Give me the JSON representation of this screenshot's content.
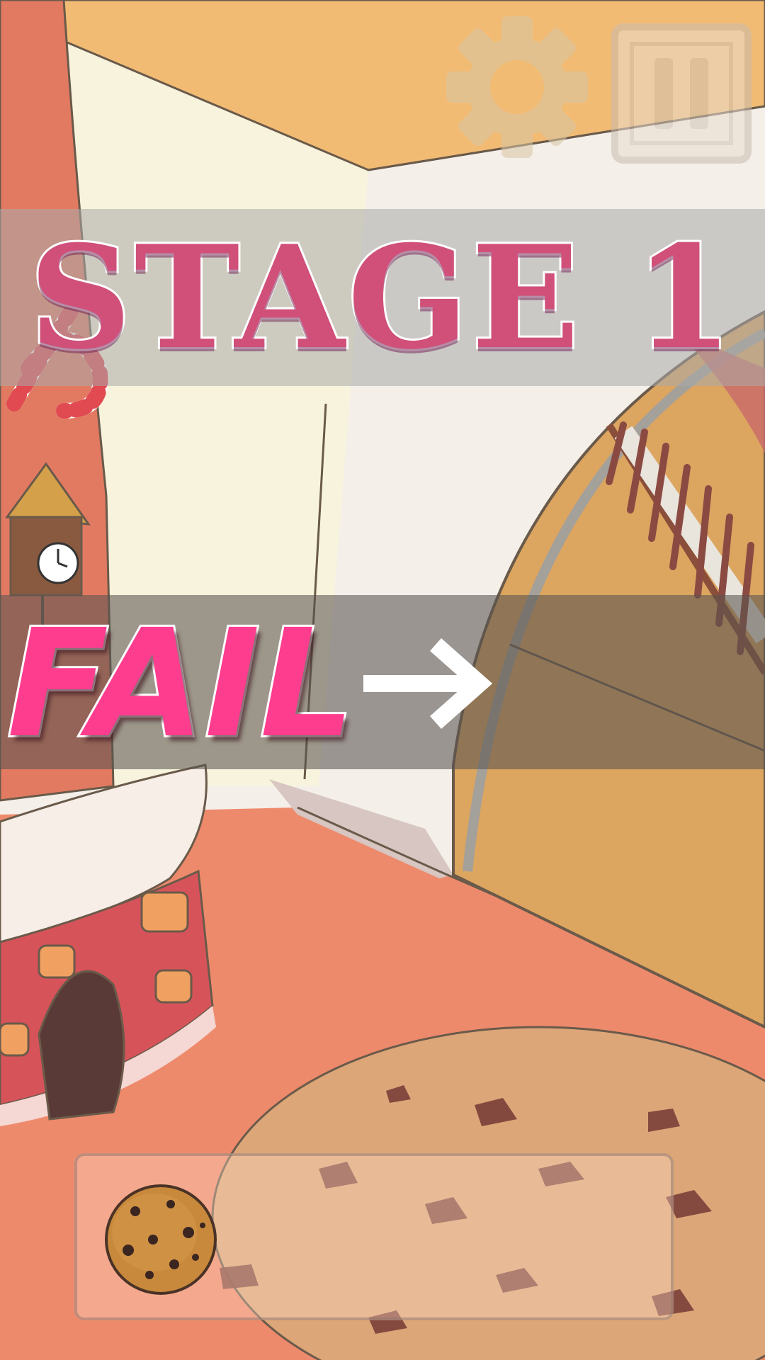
{
  "stage": {
    "title": "STAGE 1"
  },
  "result": {
    "text": "FAIL",
    "arrow_icon": "arrow-right-icon"
  },
  "toolbar": {
    "settings_icon": "gear-icon",
    "pause_icon": "pause-icon"
  },
  "inventory": {
    "items": [
      {
        "icon": "cookie-icon"
      }
    ]
  },
  "colors": {
    "stage_text": "#d0507a",
    "fail_text": "#ff3d8f",
    "floor": "#ee8a6c",
    "wall": "#f6f0ea",
    "ceiling": "#f2bb74"
  }
}
